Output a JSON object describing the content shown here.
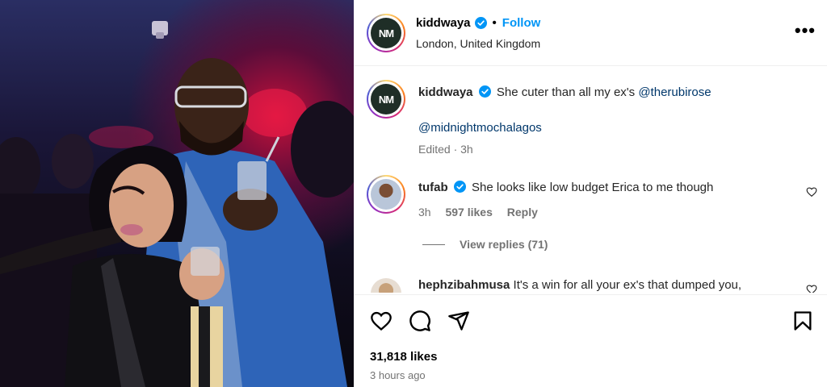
{
  "post": {
    "author": "kiddwaya",
    "follow_label": "Follow",
    "separator": "•",
    "location": "London, United Kingdom",
    "more_label": "•••",
    "avatar_initials": "NM"
  },
  "caption": {
    "username": "kiddwaya",
    "text": "She cuter than all my ex's",
    "mention1": "@therubirose",
    "mention2": "@midnightmochalagos",
    "meta": "Edited · 3h"
  },
  "comments": [
    {
      "username": "tufab",
      "text": "She looks like low budget Erica to me though",
      "time": "3h",
      "likes": "597 likes",
      "reply_label": "Reply",
      "view_replies": "View replies (71)"
    },
    {
      "username": "hephzibahmusa",
      "text": "It's a win for all your ex's that dumped you,"
    }
  ],
  "engagement": {
    "likes": "31,818 likes",
    "time_ago": "3 hours ago"
  },
  "colors": {
    "link": "#0095f6",
    "mention": "#00376b",
    "muted": "#737373",
    "verified": "#0095f6"
  },
  "icons": [
    "verified-badge-icon",
    "more-options-icon",
    "heart-icon",
    "comment-icon",
    "share-icon",
    "bookmark-icon"
  ]
}
